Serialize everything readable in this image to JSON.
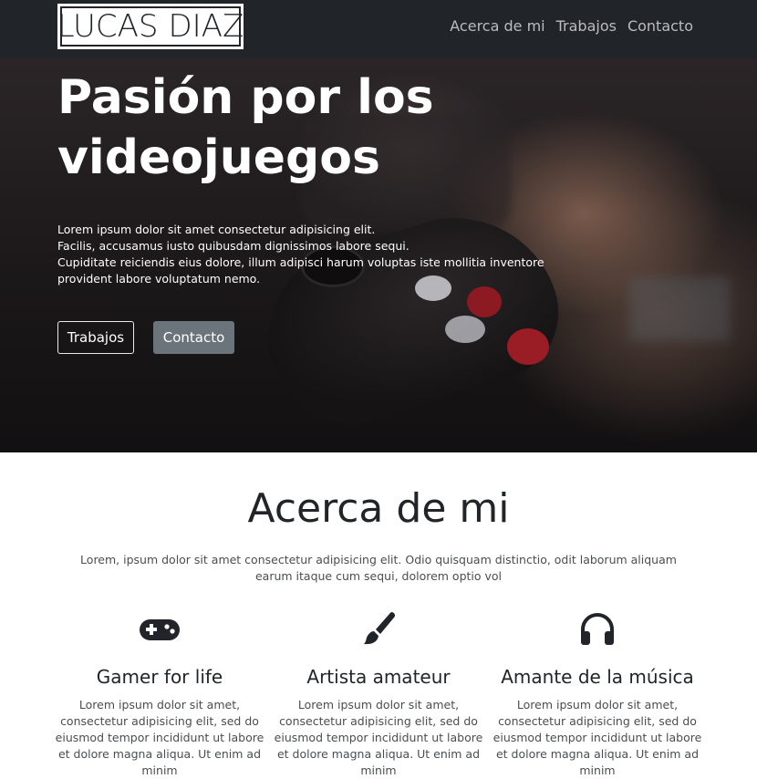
{
  "navbar": {
    "logo_first": "LUCAS",
    "logo_last": "DIAZ",
    "links": [
      "Acerca de mi",
      "Trabajos",
      "Contacto"
    ]
  },
  "hero": {
    "title": "Pasión por los videojuegos",
    "lines": [
      "Lorem ipsum dolor sit amet consectetur adipisicing elit.",
      "Facilis, accusamus iusto quibusdam dignissimos labore sequi.",
      "Cupiditate reiciendis eius dolore, illum adipisci harum voluptas iste mollitia inventore",
      "provident labore voluptatum nemo."
    ],
    "btn_trabajos": "Trabajos",
    "btn_contacto": "Contacto"
  },
  "about": {
    "title": "Acerca de mi",
    "intro": "Lorem, ipsum dolor sit amet consectetur adipisicing elit. Odio quisquam distinctio, odit laborum aliquam earum itaque cum sequi, dolorem optio vol",
    "features": [
      {
        "icon": "gamepad-icon",
        "title": "Gamer for life",
        "text": "Lorem ipsum dolor sit amet, consectetur adipisicing elit, sed do eiusmod tempor incididunt ut labore et dolore magna aliqua. Ut enim ad minim"
      },
      {
        "icon": "paintbrush-icon",
        "title": "Artista amateur",
        "text": "Lorem ipsum dolor sit amet, consectetur adipisicing elit, sed do eiusmod tempor incididunt ut labore et dolore magna aliqua. Ut enim ad minim"
      },
      {
        "icon": "headphones-icon",
        "title": "Amante de la música",
        "text": "Lorem ipsum dolor sit amet, consectetur adipisicing elit, sed do eiusmod tempor incididunt ut labore et dolore magna aliqua. Ut enim ad minim"
      }
    ]
  },
  "colors": {
    "navbar_bg": "#212429",
    "nav_link": "#b9bcc0",
    "secondary_button": "#6b737b",
    "heading": "#212529"
  }
}
